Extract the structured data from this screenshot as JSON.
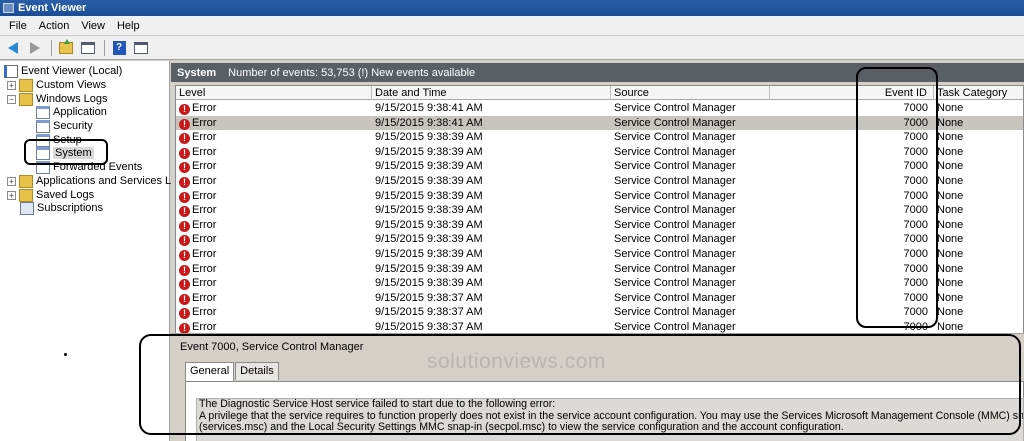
{
  "window": {
    "title": "Event Viewer"
  },
  "menu": [
    "File",
    "Action",
    "View",
    "Help"
  ],
  "toolbar": {
    "icons": [
      "back-arrow-icon",
      "forward-arrow-icon",
      "up-folder-icon",
      "show-hide-tree-icon",
      "help-icon",
      "action-pane-icon"
    ]
  },
  "tree": {
    "root": "Event Viewer (Local)",
    "custom_views": "Custom Views",
    "windows_logs": "Windows Logs",
    "application": "Application",
    "security": "Security",
    "setup": "Setup",
    "system": "System",
    "forwarded": "Forwarded Events",
    "app_services": "Applications and Services Logs",
    "saved_logs": "Saved Logs",
    "subscriptions": "Subscriptions"
  },
  "log_header": {
    "title": "System",
    "info": "Number of events: 53,753 (!) New events available"
  },
  "columns": [
    "Level",
    "Date and Time",
    "Source",
    "Event ID",
    "Task Category"
  ],
  "events": [
    {
      "level": "Error",
      "datetime": "9/15/2015 9:38:41 AM",
      "source": "Service Control Manager",
      "event_id": "7000",
      "category": "None"
    },
    {
      "level": "Error",
      "datetime": "9/15/2015 9:38:41 AM",
      "source": "Service Control Manager",
      "event_id": "7000",
      "category": "None"
    },
    {
      "level": "Error",
      "datetime": "9/15/2015 9:38:39 AM",
      "source": "Service Control Manager",
      "event_id": "7000",
      "category": "None"
    },
    {
      "level": "Error",
      "datetime": "9/15/2015 9:38:39 AM",
      "source": "Service Control Manager",
      "event_id": "7000",
      "category": "None"
    },
    {
      "level": "Error",
      "datetime": "9/15/2015 9:38:39 AM",
      "source": "Service Control Manager",
      "event_id": "7000",
      "category": "None"
    },
    {
      "level": "Error",
      "datetime": "9/15/2015 9:38:39 AM",
      "source": "Service Control Manager",
      "event_id": "7000",
      "category": "None"
    },
    {
      "level": "Error",
      "datetime": "9/15/2015 9:38:39 AM",
      "source": "Service Control Manager",
      "event_id": "7000",
      "category": "None"
    },
    {
      "level": "Error",
      "datetime": "9/15/2015 9:38:39 AM",
      "source": "Service Control Manager",
      "event_id": "7000",
      "category": "None"
    },
    {
      "level": "Error",
      "datetime": "9/15/2015 9:38:39 AM",
      "source": "Service Control Manager",
      "event_id": "7000",
      "category": "None"
    },
    {
      "level": "Error",
      "datetime": "9/15/2015 9:38:39 AM",
      "source": "Service Control Manager",
      "event_id": "7000",
      "category": "None"
    },
    {
      "level": "Error",
      "datetime": "9/15/2015 9:38:39 AM",
      "source": "Service Control Manager",
      "event_id": "7000",
      "category": "None"
    },
    {
      "level": "Error",
      "datetime": "9/15/2015 9:38:39 AM",
      "source": "Service Control Manager",
      "event_id": "7000",
      "category": "None"
    },
    {
      "level": "Error",
      "datetime": "9/15/2015 9:38:39 AM",
      "source": "Service Control Manager",
      "event_id": "7000",
      "category": "None"
    },
    {
      "level": "Error",
      "datetime": "9/15/2015 9:38:37 AM",
      "source": "Service Control Manager",
      "event_id": "7000",
      "category": "None"
    },
    {
      "level": "Error",
      "datetime": "9/15/2015 9:38:37 AM",
      "source": "Service Control Manager",
      "event_id": "7000",
      "category": "None"
    },
    {
      "level": "Error",
      "datetime": "9/15/2015 9:38:37 AM",
      "source": "Service Control Manager",
      "event_id": "7000",
      "category": "None"
    },
    {
      "level": "Error",
      "datetime": "9/15/2015 9:38:37 AM",
      "source": "Service Control Manager",
      "event_id": "7000",
      "category": "None"
    }
  ],
  "detail": {
    "title": "Event 7000, Service Control Manager",
    "watermark": "solutionviews.com",
    "tabs": [
      "General",
      "Details"
    ],
    "lines": [
      "The Diagnostic Service Host service failed to start due to the following error:",
      "A privilege that the service requires to function properly does not exist in the service account configuration. You may use the Services Microsoft Management Console (MMC) snap-in",
      "(services.msc) and the Local Security Settings MMC snap-in (secpol.msc) to view the service configuration and the account configuration."
    ]
  },
  "colors": {
    "titlebar": "#1f5aa0",
    "header_bar": "#5a5f66",
    "error": "#c81818",
    "selected_row": "#c8c4c0"
  }
}
